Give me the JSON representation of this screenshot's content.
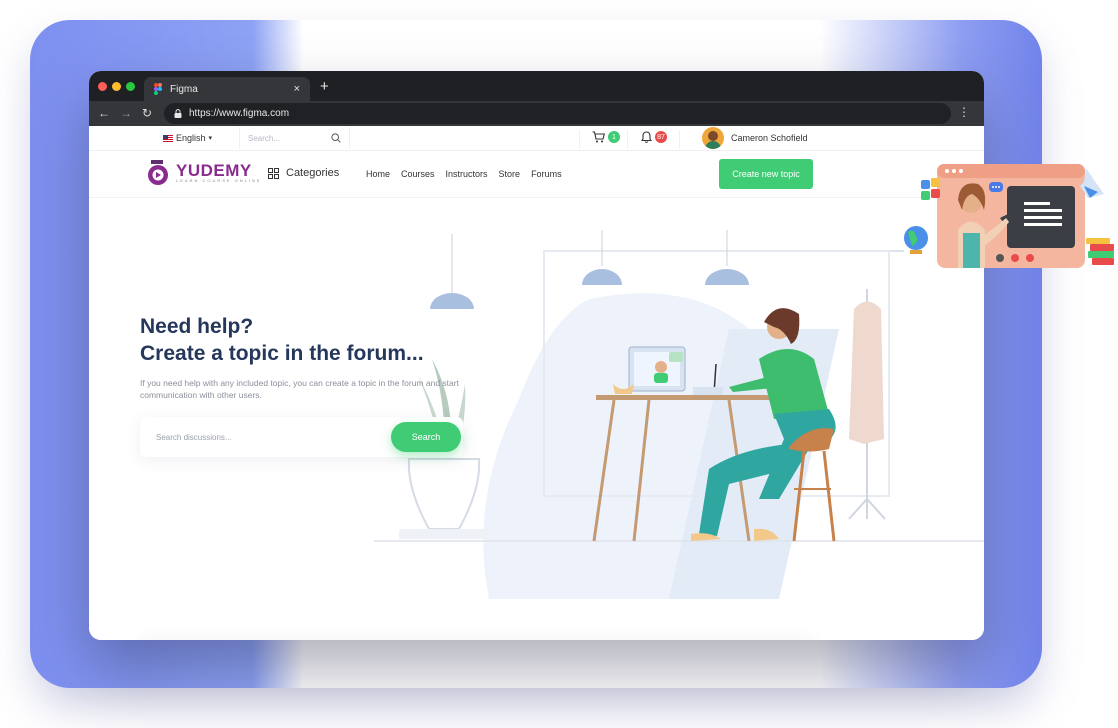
{
  "browser": {
    "tab_title": "Figma",
    "tab_close": "×",
    "new_tab": "+",
    "url": "https://www.figma.com",
    "nav_back": "←",
    "nav_forward": "→",
    "nav_reload": "↻",
    "menu": "⋮"
  },
  "topbar": {
    "language": "English",
    "language_caret": "▾",
    "search_placeholder": "Search...",
    "cart_count": "1",
    "notification_count": "87",
    "user_name": "Cameron Schofield"
  },
  "navbar": {
    "logo_text": "YUDEMY",
    "logo_tagline": "LEARN COURSE ONLINE",
    "categories_label": "Categories",
    "menu_items": [
      "Home",
      "Courses",
      "Instructors",
      "Store",
      "Forums"
    ],
    "cta_label": "Create new topic"
  },
  "hero": {
    "title_line1": "Need help?",
    "title_line2": "Create a topic in the forum...",
    "description": "If you need help with any included topic, you can create a topic in the forum and start communication with other users.",
    "search_placeholder": "Search discussions...",
    "search_button": "Search"
  },
  "features": {
    "icons": [
      "chat-bot-icon",
      "document-edit-icon",
      "conversation-icon",
      "user-profile-icon"
    ]
  },
  "colors": {
    "brand_green": "#3fcc74",
    "heading_navy": "#26375c",
    "logo_purple": "#8a2c8e",
    "cart_badge": "#3fcc74",
    "notification_badge": "#e94b4b",
    "background_blue": "#7d8ff0"
  }
}
